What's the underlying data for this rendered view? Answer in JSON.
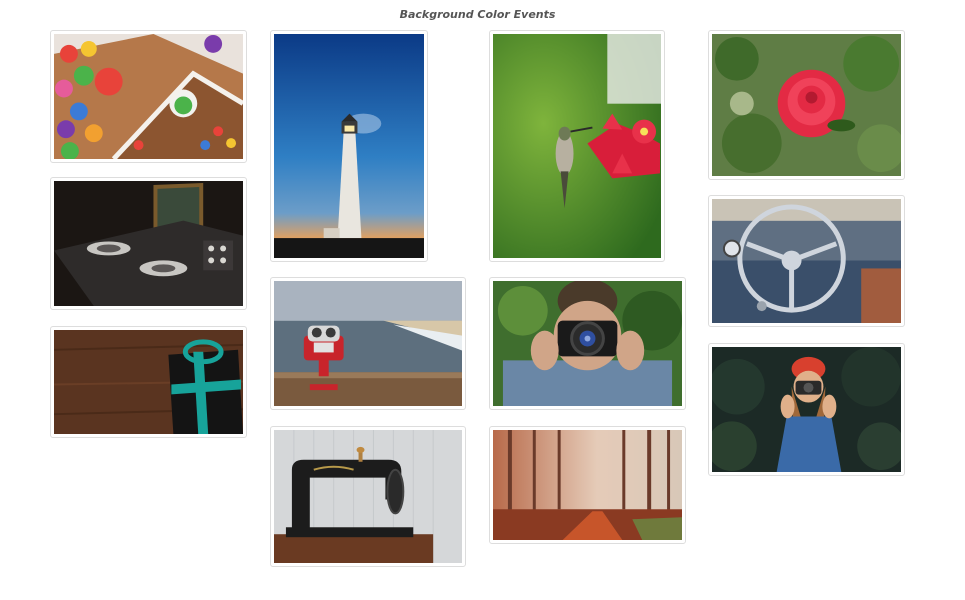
{
  "header": {
    "title": "Background Color Events"
  },
  "gallery": {
    "images": [
      {
        "name": "gingerbread-house-candy-photo",
        "icon": "photo-gingerbread"
      },
      {
        "name": "lighthouse-night-sky-photo",
        "icon": "photo-lighthouse"
      },
      {
        "name": "hummingbird-feeder-photo",
        "icon": "photo-hummingbird"
      },
      {
        "name": "red-rose-photo",
        "icon": "photo-rose"
      },
      {
        "name": "dj-turntable-laptop-photo",
        "icon": "photo-dj"
      },
      {
        "name": "coin-binoculars-beach-photo",
        "icon": "photo-binoculars"
      },
      {
        "name": "photographer-camera-man-photo",
        "icon": "photo-photographer"
      },
      {
        "name": "vintage-car-steering-wheel-photo",
        "icon": "photo-steering-wheel"
      },
      {
        "name": "gift-box-wood-table-photo",
        "icon": "photo-gift"
      },
      {
        "name": "sewing-machine-photo",
        "icon": "photo-sewing-machine"
      },
      {
        "name": "autumn-forest-path-photo",
        "icon": "photo-forest"
      },
      {
        "name": "woman-red-hat-camera-photo",
        "icon": "photo-woman-camera"
      }
    ]
  }
}
